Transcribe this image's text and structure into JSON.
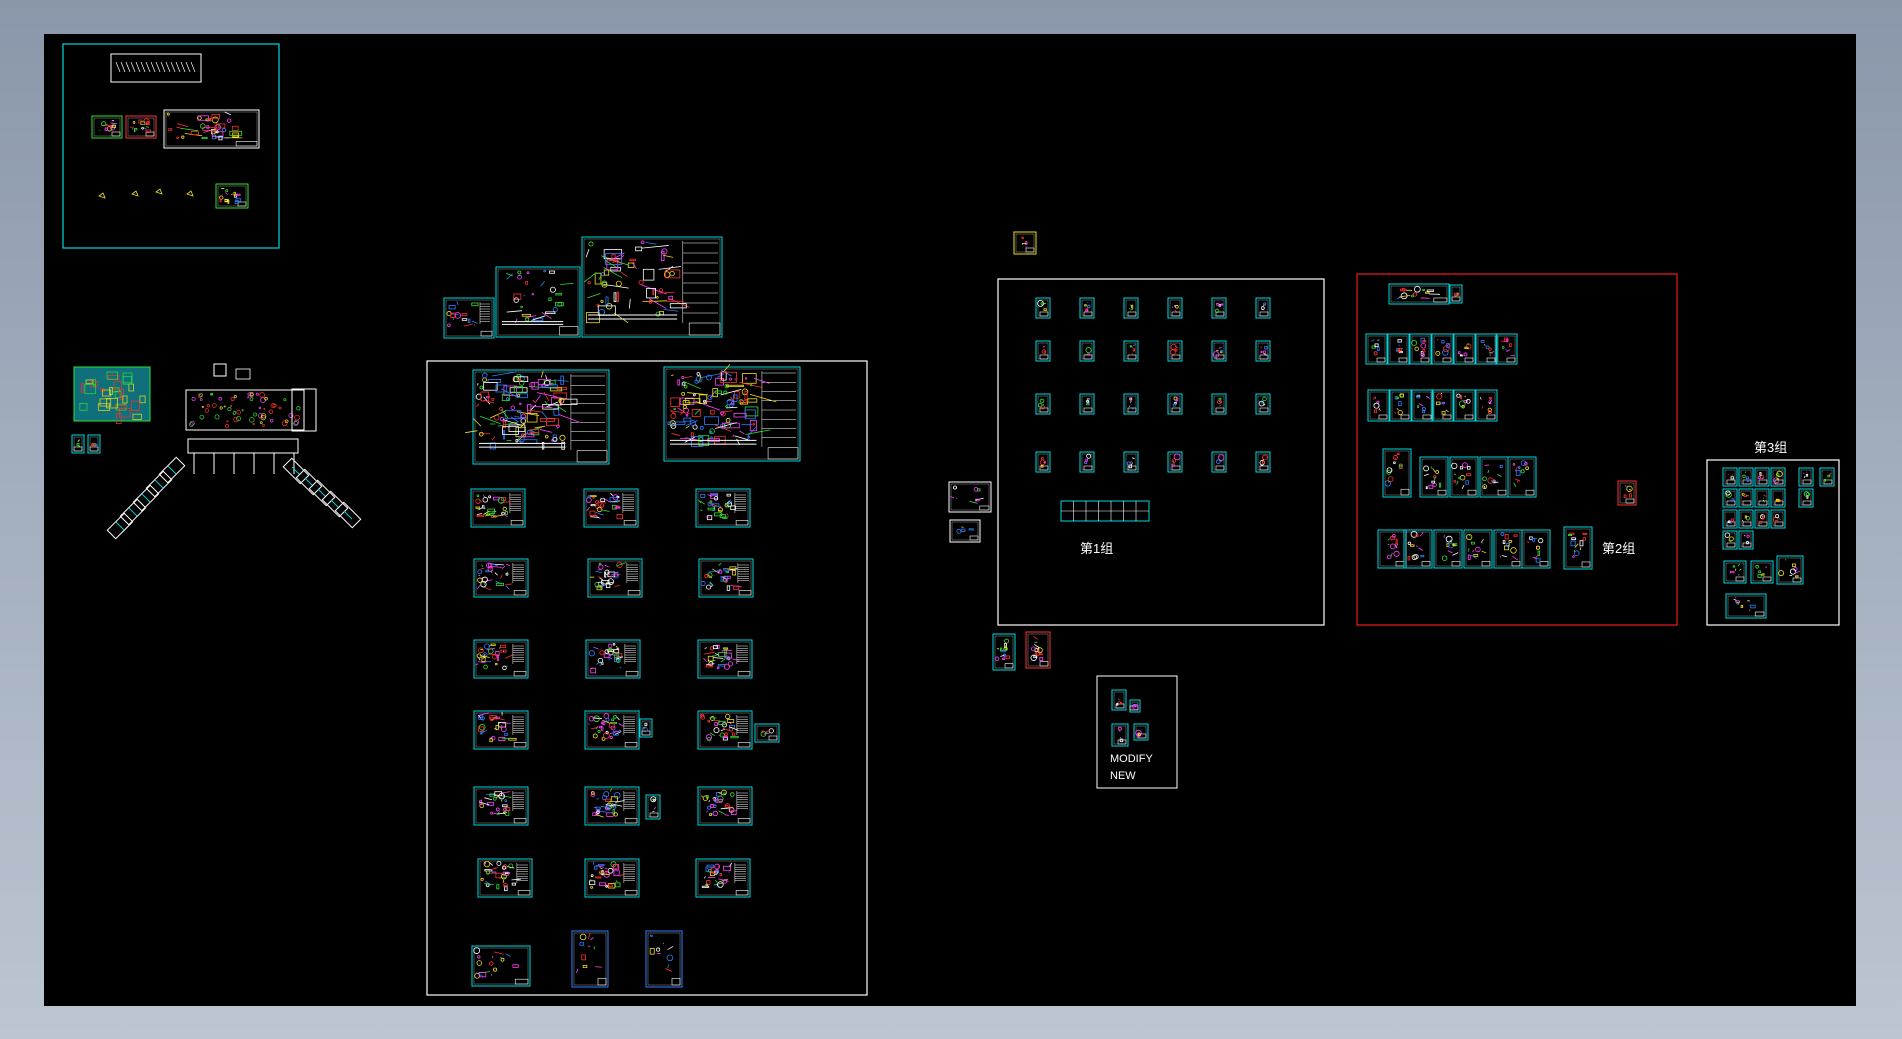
{
  "viewport": {
    "background": "#000000",
    "colors": {
      "frame": "#ffffff",
      "group_highlight": "#d01818",
      "sheet_border": "#00d8e0",
      "geometry_red": "#ff3030",
      "geometry_yellow": "#f0e020",
      "geometry_green": "#30e030",
      "geometry_magenta": "#ff40ff",
      "geometry_blue": "#2f7fff"
    }
  },
  "labels": {
    "group_1": "第1组",
    "group_2": "第2组",
    "group_3": "第3组",
    "note_line_1": "MODIFY",
    "note_line_2": "NEW"
  }
}
